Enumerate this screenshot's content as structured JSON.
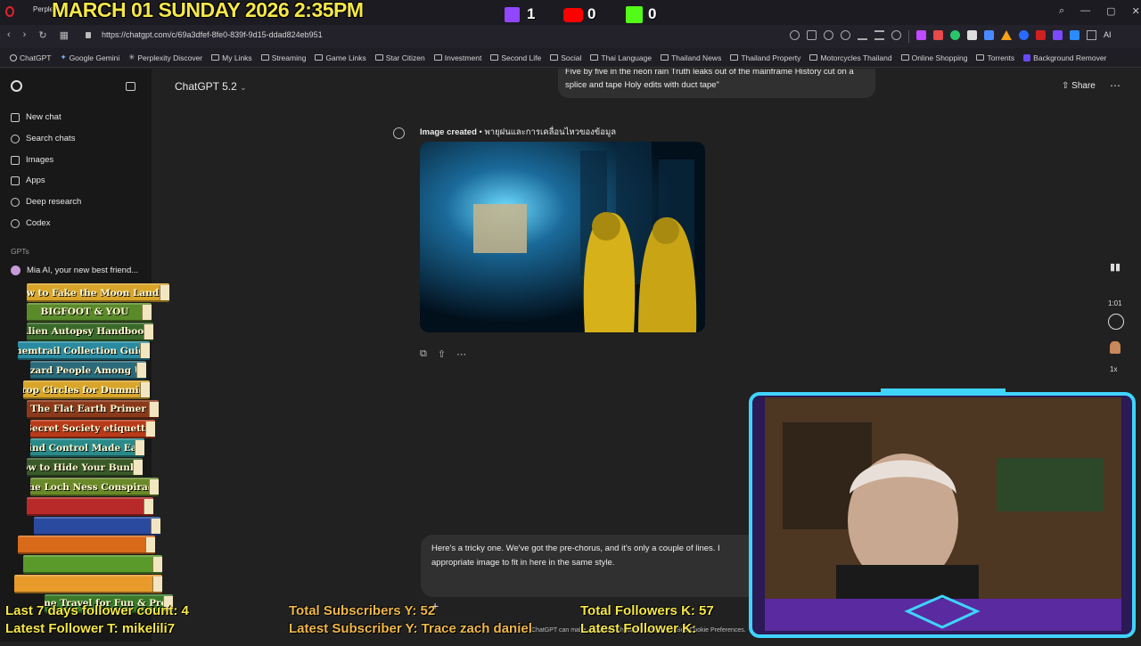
{
  "browser": {
    "tab_title": "Perplex",
    "url": "https://chatgpt.com/c/69a3dfef-8fe0-839f-9d15-ddad824eb951",
    "bookmarks": [
      "ChatGPT",
      "Google Gemini",
      "Perplexity Discover",
      "My Links",
      "Streaming",
      "Game Links",
      "Star Citizen",
      "Investment",
      "Second Life",
      "Social",
      "Thai Language",
      "Thailand News",
      "Thailand Property",
      "Motorcycles Thailand",
      "Online Shopping",
      "Torrents",
      "Background Remover"
    ]
  },
  "overlay": {
    "datetime": "MARCH 01 SUNDAY 2026 2:35PM",
    "twitch_count": "1",
    "youtube_count": "0",
    "kick_count": "0"
  },
  "sidebar": {
    "new_chat": "New chat",
    "search_chats": "Search chats",
    "images": "Images",
    "apps": "Apps",
    "deep_research": "Deep research",
    "codex": "Codex",
    "gpts_heading": "GPTs",
    "gpt_item": "Mia AI, your new best friend..."
  },
  "main": {
    "model": "ChatGPT 5.2",
    "share": "Share",
    "prev_message": "Five by five in the neon rain Truth leaks out of the mainframe History cut on a splice and tape Holy edits with duct tape\"",
    "image_created": "Image created",
    "image_caption": "พายุฝนและการเคลื่อนไหวของข้อมูล",
    "prompt_text": "Here's a tricky one. We've got the pre-chorus, and it's only a couple of lines. I appropriate image to fit in here in the same style.",
    "audio_time": "1:01",
    "playback_speed": "1x",
    "footer_note": "ChatGPT can make mistakes. Check important info. See Cookie Preferences."
  },
  "books": [
    {
      "title": "How to Fake the Moon Landing",
      "color": "#d8a52a"
    },
    {
      "title": "BIGFOOT & YOU",
      "color": "#5a8a2a"
    },
    {
      "title": "Alien Autopsy Handbook",
      "color": "#3a6a2a"
    },
    {
      "title": "Chemtrail Collection Guide",
      "color": "#2a8aa0"
    },
    {
      "title": "Lizard People Among Us",
      "color": "#2a6a7a"
    },
    {
      "title": "Crop Circles for Dummies",
      "color": "#d8a52a"
    },
    {
      "title": "The Flat Earth Primer",
      "color": "#8a3a1a"
    },
    {
      "title": "Secret Society etiquette",
      "color": "#b83a1a"
    },
    {
      "title": "Mind Control Made Easy",
      "color": "#2a8a8a"
    },
    {
      "title": "How to Hide Your Bunker",
      "color": "#3a5a2a"
    },
    {
      "title": "The Loch Ness Conspiracy",
      "color": "#6a8a2a"
    },
    {
      "title": "",
      "color": "#b82a2a"
    },
    {
      "title": "",
      "color": "#2a4aa0"
    },
    {
      "title": "",
      "color": "#d86a1a"
    },
    {
      "title": "",
      "color": "#5a9a2a"
    },
    {
      "title": "",
      "color": "#e89a2a"
    },
    {
      "title": "Time Travel for Fun & Profit",
      "color": "#3a7a2a"
    }
  ],
  "stream_stats": {
    "followers_7days": "Last 7 days follower count: 4",
    "latest_follower_t": "Latest Follower T: mikelili7",
    "total_subs_y": "Total Subscribers Y: 52",
    "latest_sub_y": "Latest Subscriber Y: Trace zach daniel",
    "total_followers_k": "Total Followers K: 57",
    "latest_follower_k": "Latest Follower K:"
  },
  "colors": {
    "overlay_yellow": "#f5e74a",
    "cam_frame_cyan": "#3fd4ff",
    "cam_frame_purple": "#7a3cff"
  }
}
